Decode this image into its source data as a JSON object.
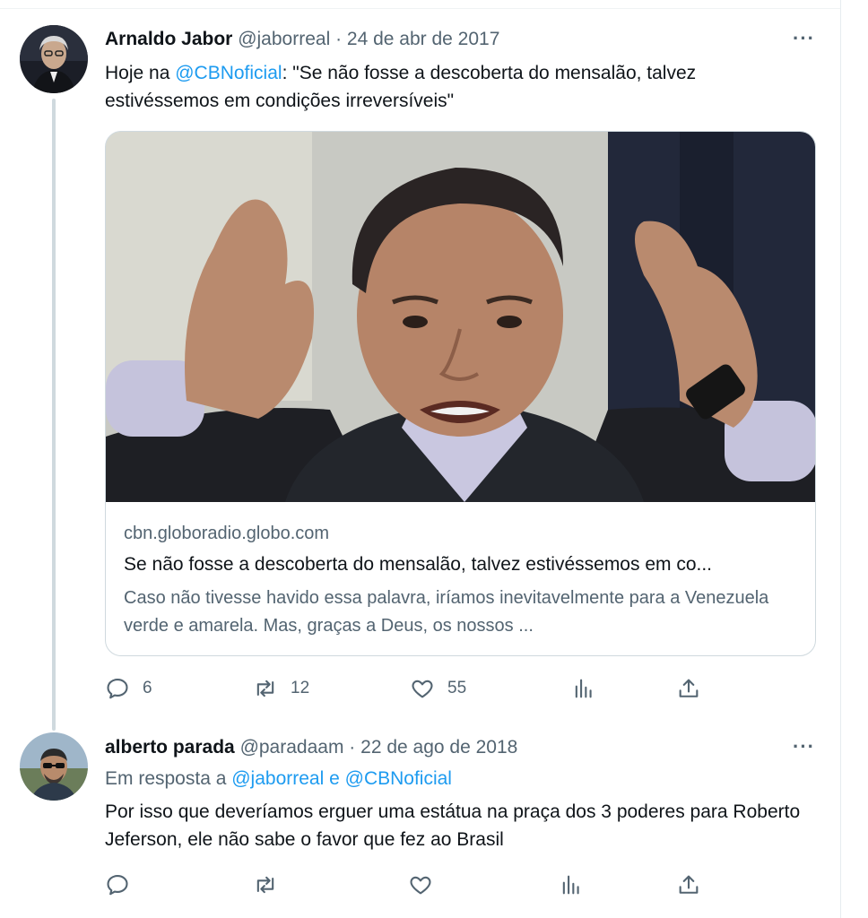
{
  "tweets": [
    {
      "author_name": "Arnaldo Jabor",
      "handle": "@jaborreal",
      "separator": "·",
      "date": "24 de abr de 2017",
      "more": "···",
      "text_prefix": "Hoje na ",
      "mention": "@CBNoficial",
      "text_suffix": ": \"Se não fosse a descoberta do mensalão, talvez estivéssemos em condições irreversíveis\"",
      "card": {
        "domain": "cbn.globoradio.globo.com",
        "title": "Se não fosse a descoberta do mensalão, talvez estivéssemos em co...",
        "description": "Caso não tivesse havido essa palavra, iríamos inevitavelmente para a Venezuela verde e amarela. Mas, graças a Deus, os nossos ..."
      },
      "counts": {
        "replies": "6",
        "retweets": "12",
        "likes": "55"
      }
    },
    {
      "author_name": "alberto parada",
      "handle": "@paradaam",
      "separator": "·",
      "date": "22 de ago de 2018",
      "more": "···",
      "reply_prefix": "Em resposta a ",
      "reply_to_1": "@jaborreal",
      "reply_conj": " e ",
      "reply_to_2": "@CBNoficial",
      "text": "Por isso que deveríamos erguer uma estátua na praça dos 3 poderes para Roberto Jeferson, ele não sabe o favor que fez ao Brasil"
    }
  ],
  "icons": [
    "reply-icon",
    "retweet-icon",
    "like-icon",
    "views-icon",
    "share-icon"
  ],
  "colors": {
    "link": "#1d9bf0",
    "muted": "#536471",
    "text": "#0f1419",
    "border": "#cfd9de"
  }
}
